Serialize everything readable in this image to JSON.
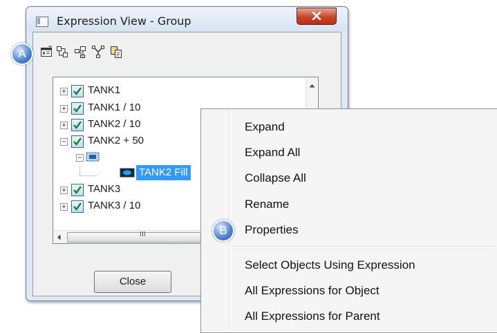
{
  "window": {
    "title": "Expression View - Group",
    "close_glyph": "×"
  },
  "toolbar": {
    "icons": [
      "properties-icon",
      "expand-tree-icon",
      "object-network-icon",
      "parent-network-icon",
      "copy-icon"
    ]
  },
  "callouts": {
    "a": "A",
    "b": "B"
  },
  "tree": {
    "items": [
      {
        "label": "TANK1",
        "expander": "+"
      },
      {
        "label": "TANK1 / 10",
        "expander": "+"
      },
      {
        "label": "TANK2 / 10",
        "expander": "+"
      },
      {
        "label": "TANK2 + 50",
        "expander": "−"
      },
      {
        "label": "",
        "expander": "−"
      },
      {
        "label": "TANK2 Fill",
        "selected": true
      },
      {
        "label": "TANK3",
        "expander": "+"
      },
      {
        "label": "TANK3 / 10",
        "expander": "+"
      }
    ],
    "scroll_grip": "III"
  },
  "buttons": {
    "close": "Close"
  },
  "context_menu": {
    "items": [
      "Expand",
      "Expand All",
      "Collapse All",
      "Rename",
      "Properties",
      "Select Objects Using Expression",
      "All Expressions for Object",
      "All Expressions for Parent"
    ]
  },
  "colors": {
    "selection": "#3399ff",
    "callout": "#4d82cc",
    "checkbox": "#2f6a8f"
  }
}
